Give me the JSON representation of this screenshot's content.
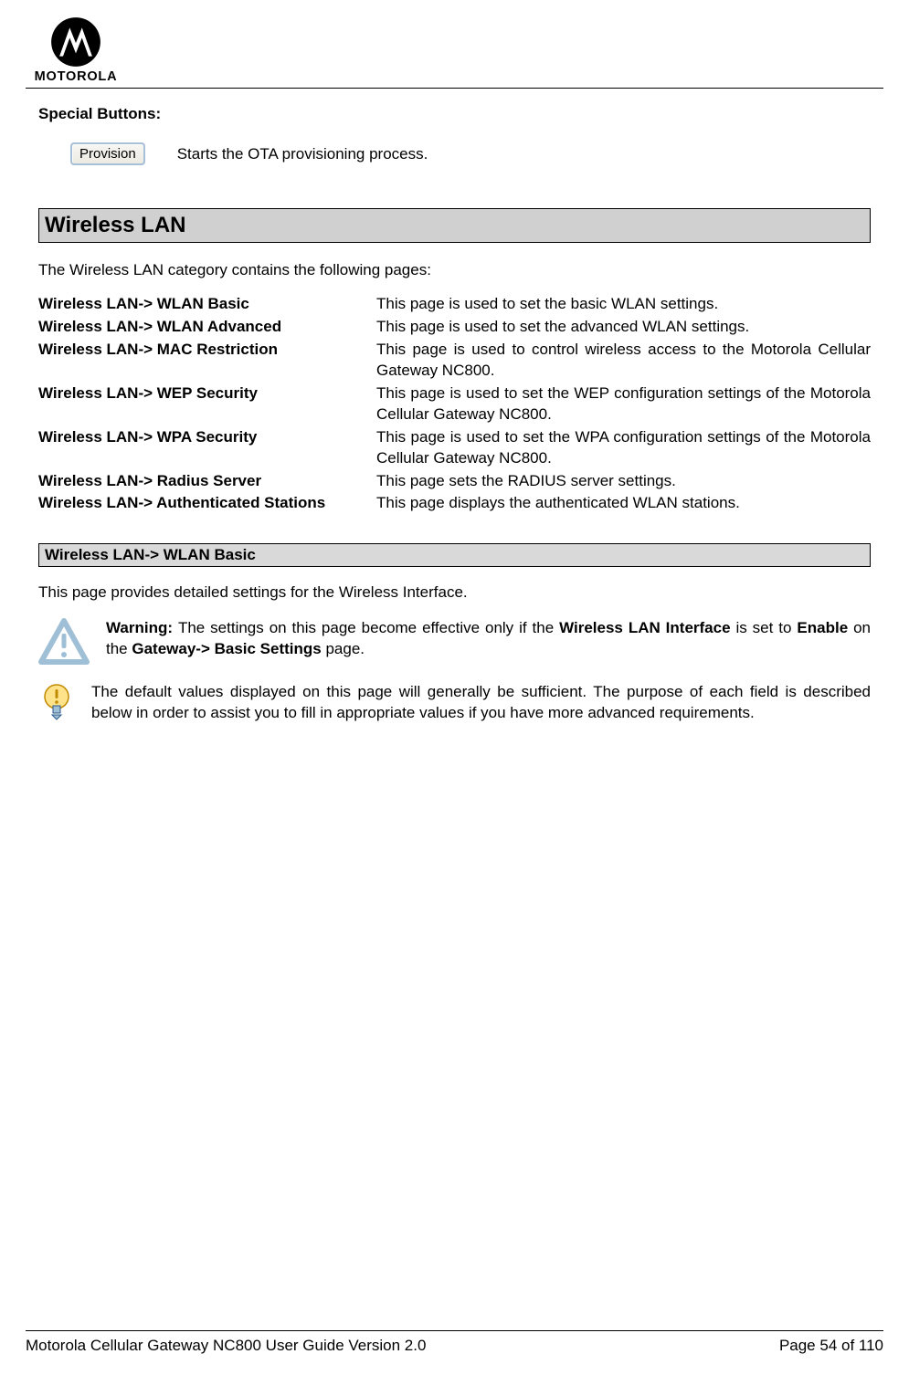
{
  "brand": "MOTOROLA",
  "special_buttons_label": "Special Buttons",
  "provision_button": "Provision",
  "provision_desc": "Starts the OTA provisioning process.",
  "section_title": "Wireless LAN",
  "section_intro": "The Wireless LAN category contains the following pages:",
  "nav": [
    {
      "label": "Wireless LAN-> WLAN Basic",
      "desc": "This page is used to set the basic WLAN settings."
    },
    {
      "label": "Wireless LAN-> WLAN Advanced",
      "desc": "This page is used to set the advanced WLAN settings."
    },
    {
      "label": "Wireless LAN-> MAC Restriction",
      "desc": "This page is used to control wireless access to the Motorola Cellular Gateway NC800."
    },
    {
      "label": "Wireless LAN-> WEP Security",
      "desc": "This page is used to set the WEP configuration settings of the Motorola Cellular Gateway NC800."
    },
    {
      "label": "Wireless LAN-> WPA Security",
      "desc": "This page is used to set the WPA configuration settings of the Motorola Cellular Gateway NC800."
    },
    {
      "label": "Wireless LAN-> Radius Server",
      "desc": "This page sets the RADIUS server settings."
    },
    {
      "label": "Wireless LAN-> Authenticated Stations",
      "desc": "This page displays the authenticated WLAN stations."
    }
  ],
  "sub_section_title": "Wireless LAN-> WLAN Basic",
  "sub_intro": "This page provides detailed settings for the Wireless Interface.",
  "warning": {
    "prefix": "Warning: ",
    "t1": "The settings on this page become effective only if the ",
    "b1": "Wireless LAN Interface",
    "t2": " is set to ",
    "b2": "Enable",
    "t3": " on the ",
    "b3": "Gateway-> Basic Settings",
    "t4": " page."
  },
  "tip": "The default values displayed on this page will generally be sufficient. The purpose of each field is described below in order to assist you to fill in appropriate values if you have more advanced requirements.",
  "footer_left": "Motorola Cellular Gateway NC800 User Guide Version 2.0",
  "footer_right": "Page 54 of 110"
}
